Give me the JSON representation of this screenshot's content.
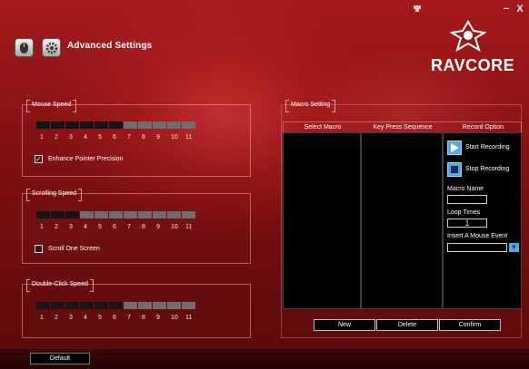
{
  "header": {
    "title": "Advanced Settings",
    "brand": "RAVCORE",
    "minimize": "−",
    "close": "X",
    "icons": [
      "mouse-icon",
      "gear-icon",
      "phoenix-logo-icon",
      "window-pin-icon"
    ]
  },
  "mouse_speed": {
    "title": "Mouse Speed",
    "level": 6,
    "max": 11,
    "numbers": [
      "1",
      "2",
      "3",
      "4",
      "5",
      "6",
      "7",
      "8",
      "9",
      "10",
      "11"
    ],
    "option_label": "Enhance Pointer Precision",
    "option_checked": true
  },
  "scrolling_speed": {
    "title": "Scrolling Speed",
    "level": 3,
    "max": 11,
    "numbers": [
      "1",
      "2",
      "3",
      "4",
      "5",
      "6",
      "7",
      "8",
      "9",
      "10",
      "11"
    ],
    "option_label": "Scroll One Screen",
    "option_checked": false
  },
  "double_click_speed": {
    "title": "Double-Click Speed",
    "level": 6,
    "max": 11,
    "numbers": [
      "1",
      "2",
      "3",
      "4",
      "5",
      "6",
      "7",
      "8",
      "9",
      "10",
      "11"
    ]
  },
  "macro": {
    "title": "Macro Setting",
    "col_select": "Select Macro",
    "col_keys": "Key Press Sequence",
    "col_record": "Record Option",
    "start_recording": "Start Recording",
    "stop_recording": "Stop Recording",
    "macro_name_label": "Macro Name",
    "macro_name_value": "",
    "loop_times_label": "Loop Times",
    "loop_times_value": "1",
    "insert_event_label": "Insert A Mouse Event",
    "insert_event_value": "",
    "new_label": "New",
    "delete_label": "Delete",
    "confirm_label": "Confirm"
  },
  "footer": {
    "default_label": "Default"
  },
  "colors": {
    "background": "#8a1214",
    "accent_blue": "#5aa6e0",
    "segment_on": "#151515",
    "segment_off": "#6e6e6e"
  }
}
